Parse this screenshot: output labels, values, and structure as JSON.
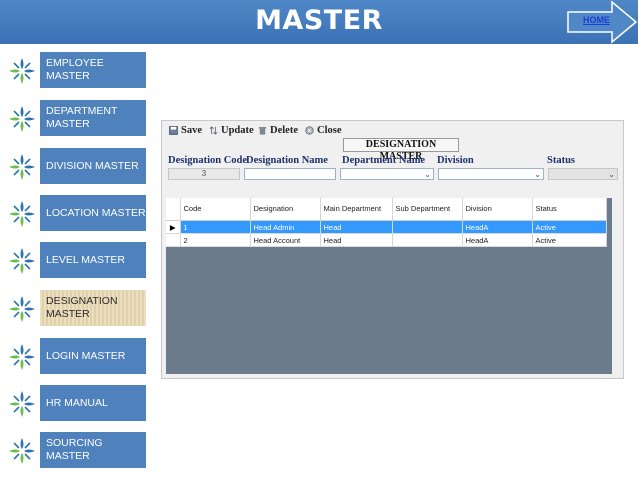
{
  "header": {
    "title": "MASTER",
    "home_label": "HOME"
  },
  "sidebar": {
    "items": [
      {
        "label": "EMPLOYEE MASTER",
        "active": false
      },
      {
        "label": "DEPARTMENT MASTER",
        "active": false
      },
      {
        "label": "DIVISION MASTER",
        "active": false
      },
      {
        "label": "LOCATION MASTER",
        "active": false
      },
      {
        "label": "LEVEL MASTER",
        "active": false
      },
      {
        "label": "DESIGNATION MASTER",
        "active": true
      },
      {
        "label": "LOGIN MASTER",
        "active": false
      },
      {
        "label": "HR MANUAL",
        "active": false
      },
      {
        "label": "SOURCING MASTER",
        "active": false
      }
    ],
    "icon": "four-petal-plus-icon",
    "colors": {
      "item_bg": "#4f81bd",
      "active_bg": "#e7d8b2",
      "icon_blue": "#2e74b5",
      "icon_green": "#6abf4b"
    }
  },
  "app": {
    "toolbar": {
      "save": "Save",
      "update": "Update",
      "delete": "Delete",
      "close": "Close"
    },
    "form_title": "DESIGNATION MASTER",
    "labels": {
      "designation_code": "Designation Code",
      "designation_name": "Designation Name",
      "department_name": "Department Name",
      "division": "Division",
      "status": "Status"
    },
    "fields": {
      "designation_code_value": "3",
      "designation_name_value": "",
      "department_value": "",
      "division_value": "",
      "status_value": ""
    },
    "grid": {
      "columns": [
        "Code",
        "Designation",
        "Main Department",
        "Sub Department",
        "Division",
        "Status"
      ],
      "rows": [
        {
          "code": "1",
          "designation": "Head Admin",
          "main_department": "Head",
          "sub_department": "",
          "division": "HeadA",
          "status": "Active",
          "selected": true
        },
        {
          "code": "2",
          "designation": "Head Account",
          "main_department": "Head",
          "sub_department": "",
          "division": "HeadA",
          "status": "Active",
          "selected": false
        }
      ],
      "row_indicator": "▶"
    }
  }
}
